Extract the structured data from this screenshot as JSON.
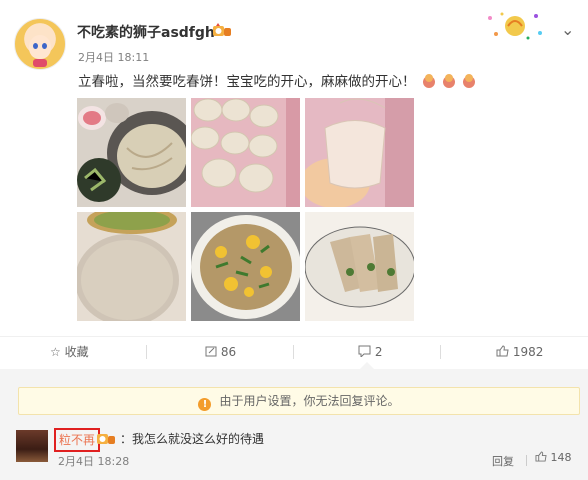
{
  "post": {
    "username": "不吃素的狮子asdfgh",
    "time": "2月4日 18:11",
    "text": "立春啦，当然要吃春饼！宝宝吃的开心，麻麻做的开心！"
  },
  "actions": {
    "favorite_label": "收藏",
    "repost_count": "86",
    "comment_count": "2",
    "like_count": "1982"
  },
  "comments": {
    "notice": "由于用户设置，你无法回复评论。",
    "items": [
      {
        "username": "粒不再",
        "text": "：我怎么就没这么好的待遇",
        "time": "2月4日 18:28",
        "reply_label": "回复",
        "like_count": "148"
      }
    ]
  },
  "colors": {
    "link": "#eb7350",
    "highlight_box": "#e02020",
    "notice_bg": "#fffbe6",
    "notice_icon": "#f39c2b",
    "comments_bg": "#f4f4f4"
  },
  "icons": [
    "avatar",
    "vip-badge-icon",
    "chevron-down-icon",
    "star-icon",
    "repost-icon",
    "comment-icon",
    "thumbs-up-icon",
    "info-icon"
  ]
}
